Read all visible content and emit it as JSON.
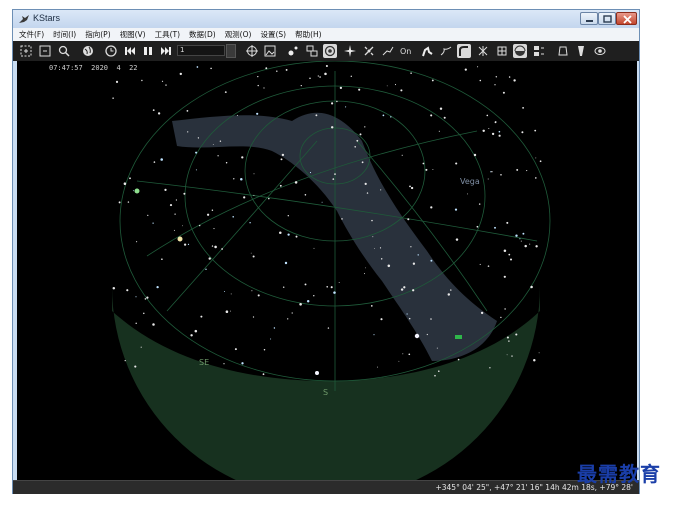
{
  "window": {
    "title": "KStars"
  },
  "menu": [
    "文件(F)",
    "时间(I)",
    "指向(P)",
    "视图(V)",
    "工具(T)",
    "数据(D)",
    "观测(O)",
    "设置(S)",
    "帮助(H)"
  ],
  "toolbar": {
    "speed_value": "1",
    "icons": [
      "zoom-in-icon",
      "zoom-out-icon",
      "find-object-icon",
      "globe-icon",
      "clock-icon",
      "step-back-icon",
      "pause-icon",
      "step-forward-icon",
      "horizon-toggle-icon",
      "image-icon",
      "stars-toggle-icon",
      "deep-sky-toggle-icon",
      "planets-toggle-icon",
      "comets-icon",
      "satellites-icon",
      "constellation-lines-icon",
      "constellation-names-icon",
      "constellation-art-icon",
      "milky-way-icon",
      "equatorial-grid-icon",
      "horizontal-grid-icon",
      "ground-toggle-icon",
      "hips-icon",
      "telescope-icon",
      "filter-icon",
      "supernova-icon"
    ]
  },
  "sky": {
    "clock_time": "07:47:57",
    "clock_date": "2020  4  22",
    "labels": {
      "vega": "Vega",
      "se": "SE",
      "s": "S"
    }
  },
  "status": {
    "coordinates": "+345° 04' 25\", +47° 21' 16\"  14h 42m 18s, +79° 28'"
  },
  "watermark": "最需教育",
  "colors": {
    "ground": "#17311f",
    "grid": "#1f5b3a",
    "milky_way": "#2e3642",
    "toolbar": "#1f1f1f",
    "titlebar": "#c9dcf1"
  }
}
